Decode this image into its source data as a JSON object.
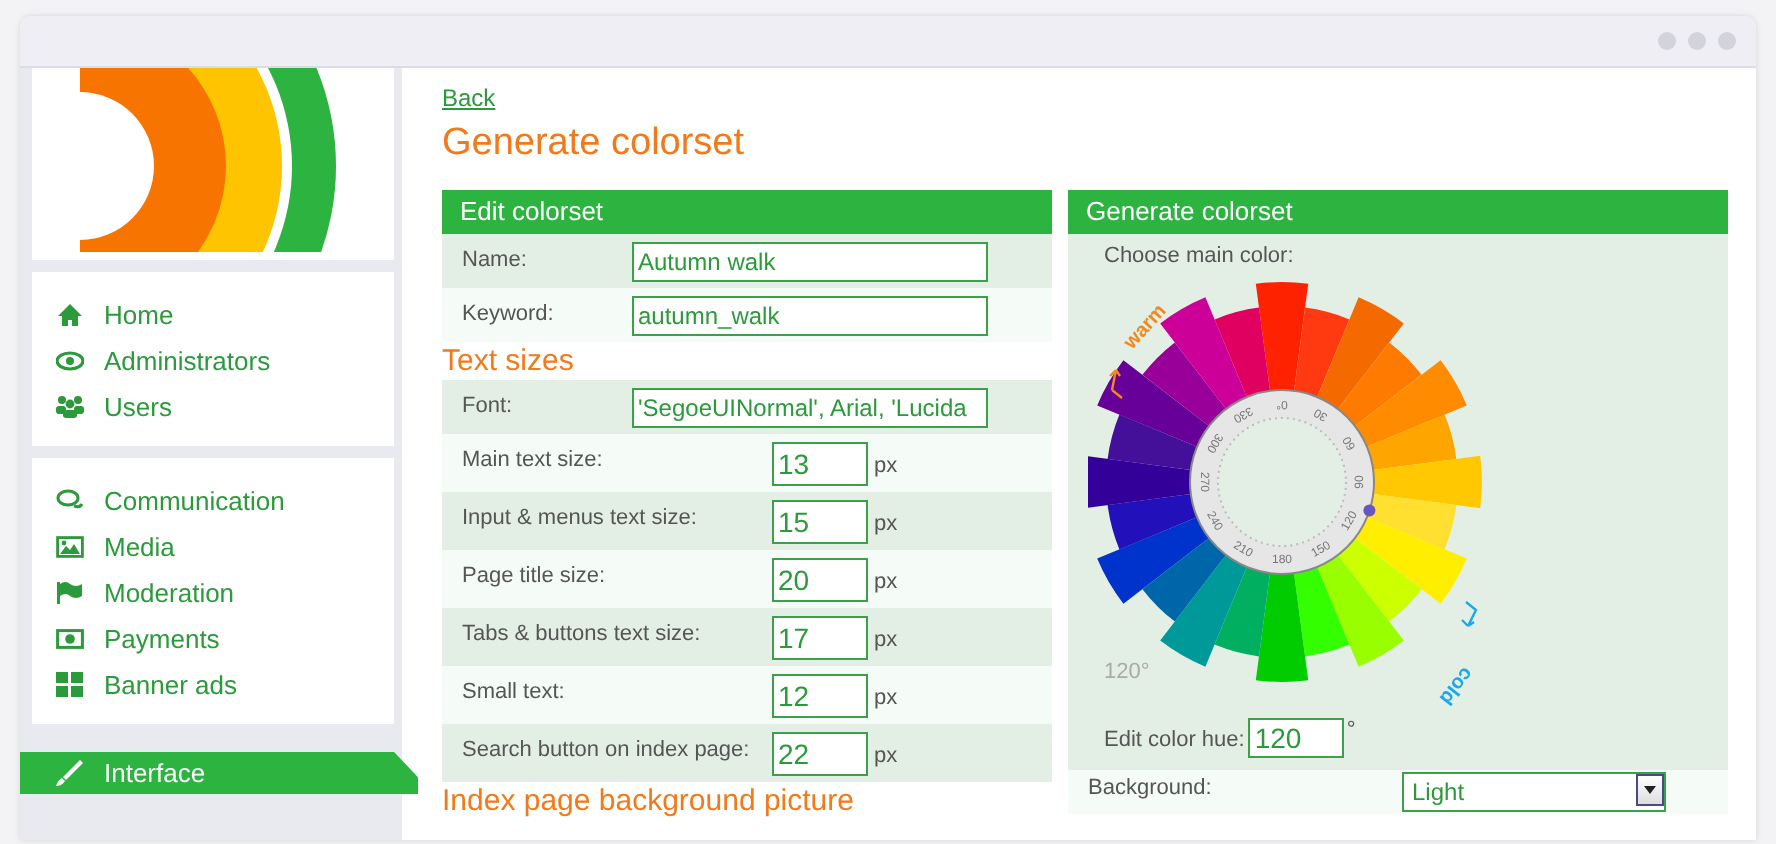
{
  "sidebar": {
    "groups": [
      {
        "items": [
          {
            "label": "Home",
            "kind": "home",
            "selected": false
          },
          {
            "label": "Administrators",
            "kind": "eye",
            "selected": false
          },
          {
            "label": "Users",
            "kind": "users",
            "selected": false
          }
        ]
      },
      {
        "items": [
          {
            "label": "Communication",
            "kind": "chat",
            "selected": false
          },
          {
            "label": "Media",
            "kind": "image",
            "selected": false
          },
          {
            "label": "Moderation",
            "kind": "flag",
            "selected": false
          },
          {
            "label": "Payments",
            "kind": "money",
            "selected": false
          },
          {
            "label": "Banner ads",
            "kind": "grid",
            "selected": false
          }
        ]
      },
      {
        "items": [
          {
            "label": "Interface",
            "kind": "brush",
            "selected": true
          }
        ]
      }
    ]
  },
  "back_link": "Back",
  "title": "Generate colorset",
  "edit_panel": {
    "title": "Edit colorset",
    "fields": [
      {
        "label": "Name:",
        "value": "Autumn walk"
      },
      {
        "label": "Keyword:",
        "value": "autumn_walk"
      }
    ],
    "section_title": "Text sizes",
    "font_field": {
      "label": "Font:",
      "value": "'SegoeUINormal', Arial, 'Lucida"
    },
    "size_fields": [
      {
        "label": "Main text size:",
        "value": "13",
        "unit": "px"
      },
      {
        "label": "Input & menus text size:",
        "value": "15",
        "unit": "px"
      },
      {
        "label": "Page title size:",
        "value": "20",
        "unit": "px"
      },
      {
        "label": "Tabs & buttons text size:",
        "value": "17",
        "unit": "px"
      },
      {
        "label": "Small text:",
        "value": "12",
        "unit": "px"
      },
      {
        "label": "Search button on index page:",
        "value": "22",
        "unit": "px"
      }
    ],
    "next_section_title": "Index page background picture"
  },
  "generate_panel": {
    "title": "Generate colorset",
    "choose_label": "Choose main color:",
    "wheel_degrees": [
      "0°",
      "30",
      "60",
      "90",
      "120",
      "150",
      "180",
      "210",
      "240",
      "270",
      "300",
      "330"
    ],
    "warm_label": "warm",
    "cold_label": "cold",
    "hue_reading": "120°",
    "hue_label": "Edit color hue:",
    "hue_value": "120",
    "hue_unit": "°",
    "background_label": "Background:",
    "background_value": "Light"
  }
}
